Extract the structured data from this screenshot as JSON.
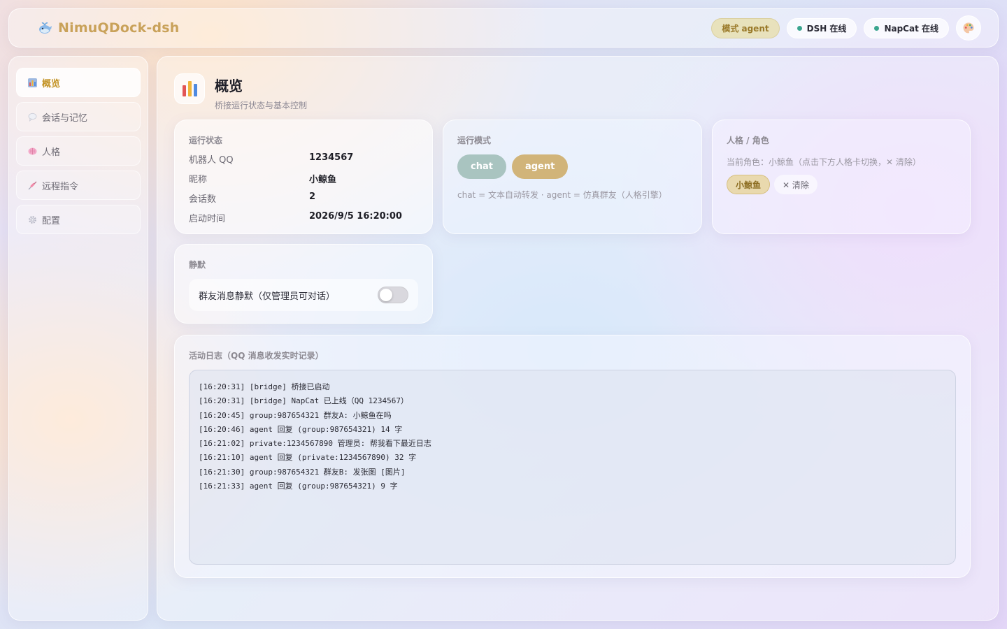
{
  "header": {
    "title": "NimuQDock-dsh",
    "mode_pill": "模式 agent",
    "dsh_status": "DSH 在线",
    "napcat_status": "NapCat 在线",
    "status_color": "#3aa58e",
    "brand_color": "#c9a25a"
  },
  "sidebar": {
    "items": [
      {
        "label": "概览",
        "icon": "bar-chart-icon",
        "active": true
      },
      {
        "label": "会话与记忆",
        "icon": "speech-bubble-icon",
        "active": false
      },
      {
        "label": "人格",
        "icon": "brain-icon",
        "active": false
      },
      {
        "label": "远程指令",
        "icon": "syringe-icon",
        "active": false
      },
      {
        "label": "配置",
        "icon": "gear-icon",
        "active": false
      }
    ]
  },
  "page": {
    "title": "概览",
    "subtitle": "桥接运行状态与基本控制"
  },
  "status_card": {
    "label": "运行状态",
    "rows": [
      {
        "key": "机器人 QQ",
        "value": "1234567"
      },
      {
        "key": "昵称",
        "value": "小鲸鱼"
      },
      {
        "key": "会话数",
        "value": "2"
      },
      {
        "key": "启动时间",
        "value": "2026/9/5 16:20:00"
      }
    ]
  },
  "mode_card": {
    "label": "运行模式",
    "chat_label": "chat",
    "agent_label": "agent",
    "description": "chat = 文本自动转发 · agent = 仿真群友（人格引擎）"
  },
  "persona_card": {
    "label": "人格 / 角色",
    "current": "当前角色：小鲸鱼（点击下方人格卡切换，✕ 清除）",
    "chip": "小鲸鱼",
    "clear": "✕ 清除"
  },
  "mute_card": {
    "label": "静默",
    "toggle_label": "群友消息静默（仅管理员可对话）",
    "enabled": false
  },
  "log_card": {
    "label": "活动日志（QQ 消息收发实时记录）",
    "lines": [
      "[16:20:31] [bridge] 桥接已启动",
      "[16:20:31] [bridge] NapCat 已上线（QQ 1234567）",
      "[16:20:45] group:987654321 群友A: 小鲸鱼在吗",
      "[16:20:46] agent 回复 (group:987654321) 14 字",
      "[16:21:02] private:1234567890 管理员: 帮我看下最近日志",
      "[16:21:10] agent 回复 (private:1234567890) 32 字",
      "[16:21:30] group:987654321 群友B: 发张图 [图片]",
      "[16:21:33] agent 回复 (group:987654321) 9 字"
    ]
  }
}
